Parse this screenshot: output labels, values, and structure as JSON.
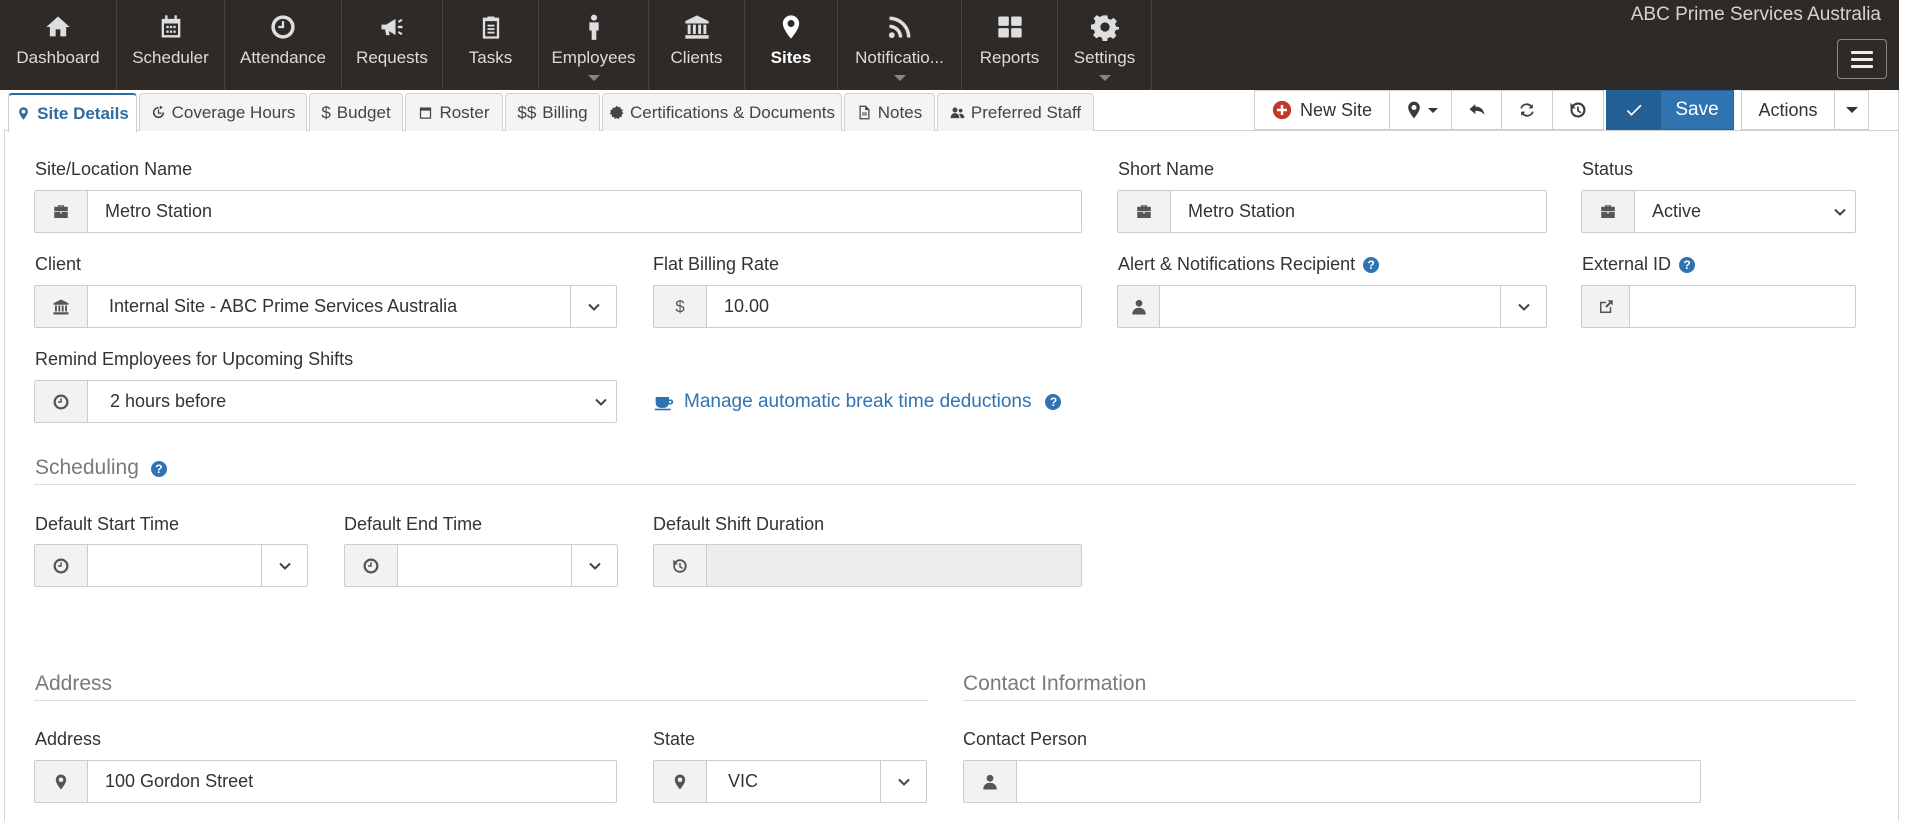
{
  "company": "ABC Prime Services Australia",
  "nav": [
    {
      "label": "Dashboard",
      "icon": "home-icon"
    },
    {
      "label": "Scheduler",
      "icon": "calendar-icon"
    },
    {
      "label": "Attendance",
      "icon": "clock-icon"
    },
    {
      "label": "Requests",
      "icon": "bullhorn-icon"
    },
    {
      "label": "Tasks",
      "icon": "clipboard-icon"
    },
    {
      "label": "Employees",
      "icon": "person-icon"
    },
    {
      "label": "Clients",
      "icon": "bank-icon"
    },
    {
      "label": "Sites",
      "icon": "map-marker-icon"
    },
    {
      "label": "Notificatio...",
      "icon": "rss-icon"
    },
    {
      "label": "Reports",
      "icon": "grid-icon"
    },
    {
      "label": "Settings",
      "icon": "gear-icon"
    }
  ],
  "tabs": [
    {
      "label": "Site Details",
      "icon": "map-marker-icon"
    },
    {
      "label": "Coverage Hours",
      "icon": "clock-refresh-icon"
    },
    {
      "label": "Budget",
      "icon": "dollar-icon"
    },
    {
      "label": "Roster",
      "icon": "calendar-icon"
    },
    {
      "label": "Billing",
      "icon": "double-dollar-icon"
    },
    {
      "label": "Certifications & Documents",
      "icon": "certificate-icon"
    },
    {
      "label": "Notes",
      "icon": "file-icon"
    },
    {
      "label": "Preferred Staff",
      "icon": "users-icon"
    }
  ],
  "toolbar": {
    "new_site": "New Site",
    "save": "Save",
    "actions": "Actions"
  },
  "form": {
    "site_name_label": "Site/Location Name",
    "site_name": "Metro Station",
    "short_name_label": "Short Name",
    "short_name": "Metro Station",
    "status_label": "Status",
    "status": "Active",
    "client_label": "Client",
    "client": "Internal Site - ABC Prime Services Australia",
    "flat_rate_label": "Flat Billing Rate",
    "flat_rate_currency": "$",
    "flat_rate": "10.00",
    "alert_label": "Alert & Notifications Recipient",
    "alert_value": "",
    "external_id_label": "External ID",
    "external_id": "",
    "remind_label": "Remind Employees for Upcoming Shifts",
    "remind_value": "2 hours before",
    "break_link": "Manage automatic break time deductions"
  },
  "scheduling": {
    "title": "Scheduling",
    "start_label": "Default Start Time",
    "start_value": "",
    "end_label": "Default End Time",
    "end_value": "",
    "duration_label": "Default Shift Duration",
    "duration_value": ""
  },
  "address": {
    "title": "Address",
    "address_label": "Address",
    "address_value": "100 Gordon Street",
    "state_label": "State",
    "state_value": "VIC"
  },
  "contact": {
    "title": "Contact Information",
    "person_label": "Contact Person",
    "person_value": ""
  },
  "help_glyph": "?",
  "colors": {
    "nav_bg": "#2d2a28",
    "accent": "#2f73b0"
  }
}
